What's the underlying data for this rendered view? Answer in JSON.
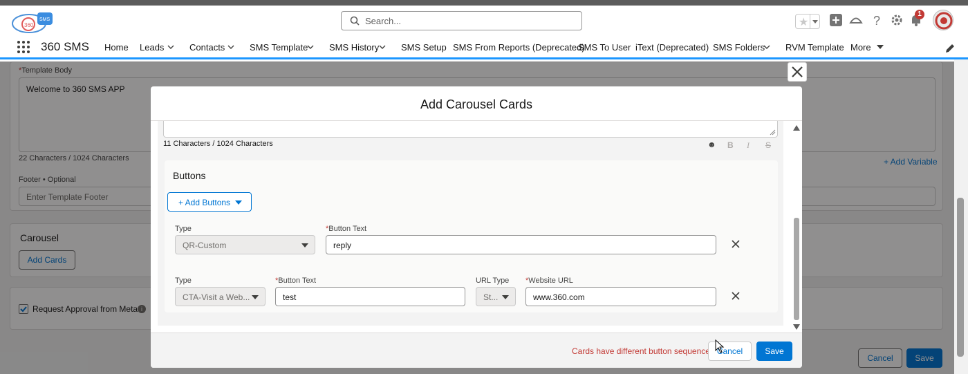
{
  "header": {
    "search_placeholder": "Search...",
    "notification_count": "1"
  },
  "nav": {
    "app_name": "360 SMS",
    "items": [
      {
        "label": "Home"
      },
      {
        "label": "Leads"
      },
      {
        "label": "Contacts"
      },
      {
        "label": "SMS Template"
      },
      {
        "label": "SMS History"
      },
      {
        "label": "SMS Setup"
      },
      {
        "label": "SMS From Reports (Deprecated)"
      },
      {
        "label": "SMS To User"
      },
      {
        "label": "iText (Deprecated)"
      },
      {
        "label": "SMS Folders"
      },
      {
        "label": "RVM Template"
      },
      {
        "label": "More"
      }
    ]
  },
  "background": {
    "template_body_label": "Template Body",
    "template_body_value": "Welcome to 360 SMS APP",
    "template_body_count": "22 Characters / 1024 Characters",
    "footer_label": "Footer • Optional",
    "footer_placeholder": "Enter Template Footer",
    "add_variable": "+ Add Variable",
    "carousel_title": "Carousel",
    "add_cards": "Add Cards",
    "request_approval": "Request Approval from Meta",
    "cancel": "Cancel",
    "save": "Save"
  },
  "modal": {
    "title": "Add Carousel Cards",
    "char_count": "11 Characters / 1024 Characters",
    "buttons_title": "Buttons",
    "add_buttons": "+ Add Buttons",
    "row1": {
      "type_label": "Type",
      "type_value": "QR-Custom",
      "button_text_label": "Button Text",
      "button_text_value": "reply"
    },
    "row2": {
      "type_label": "Type",
      "type_value": "CTA-Visit a Web...",
      "button_text_label": "Button Text",
      "button_text_value": "test",
      "url_type_label": "URL Type",
      "url_type_value": "St...",
      "website_url_label": "Website URL",
      "website_url_value": "www.360.com"
    },
    "error": "Cards have different button sequence.",
    "cancel": "Cancel",
    "save": "Save"
  },
  "colors": {
    "brand_blue": "#0176d3",
    "error_red": "#c23934",
    "nav_underline": "#1b96ff"
  }
}
